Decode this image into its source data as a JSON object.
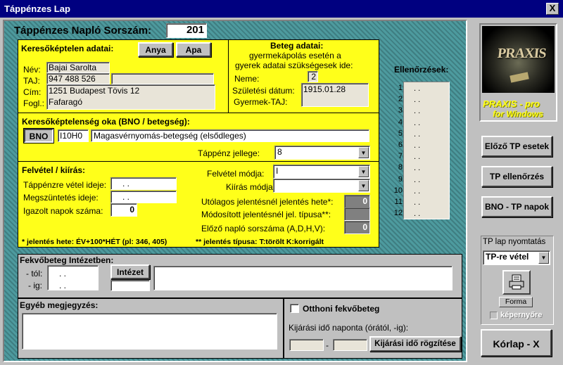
{
  "window": {
    "title": "Táppénzes Lap",
    "close_label": "X"
  },
  "header": {
    "label": "Táppénzes Napló Sorszám:",
    "value": "201"
  },
  "keresokeptelen": {
    "title": "Keresőképtelen adatai:",
    "anya_button": "Anya",
    "apa_button": "Apa",
    "fields": [
      {
        "label": "Név:",
        "value": "Bajai Sarolta"
      },
      {
        "label": "TAJ:",
        "value": "947 488 526"
      },
      {
        "label": "Cím:",
        "value": "1251 Budapest Tövis  12"
      },
      {
        "label": "Fogl.:",
        "value": "Fafaragó"
      }
    ]
  },
  "beteg": {
    "title": "Beteg adatai:",
    "subtitle_line1": "gyermekápolás esetén a",
    "subtitle_line2": "gyerek adatai szükségesek ide:",
    "neme_label": "Neme:",
    "neme_value": "2",
    "szuletesi_label": "Születési dátum:",
    "szuletesi_value": "1915.01.28",
    "gyermek_taj_label": "Gyermek-TAJ:"
  },
  "ok": {
    "title": "Keresőképtelenség oka (BNO / betegség):",
    "bno_button": "BNO",
    "bno_code": "I10H0",
    "bno_desc": "Magasvérnyomás-betegség (elsődleges)",
    "jelleg_label": "Táppénz jellege:",
    "jelleg_value": "8"
  },
  "felvetel": {
    "title": "Felvétel / kiírás:",
    "vetel_label": "Táppénzre vétel ideje:",
    "vetel_value": ". .",
    "megszuntetes_label": "Megszüntetés ideje:",
    "megszuntetes_value": ". .",
    "igazolt_label": "Igazolt napok száma:",
    "igazolt_value": "0",
    "felvetel_modja_label": "Felvétel módja:",
    "felvetel_modja_value": "I",
    "kiiras_modja_label": "Kiírás módja:",
    "kiiras_modja_value": "",
    "utolagos_label": "Utólagos jelentésnél jelentés hete*:",
    "utolagos_value": "0",
    "modositott_label": "Módosított jelentésnél jel. típusa**:",
    "modositott_value": "",
    "elozo_label": "Előző napló sorszáma (A,D,H,V):",
    "elozo_value": "0",
    "note1": "* jelentés hete:  ÉV+100*HÉT  (pl: 346, 405)",
    "note2": "** jelentés típusa:  T:törölt  K:korrigált"
  },
  "fekvobeteg": {
    "title": "Fekvőbeteg Intézetben:",
    "tol_label": "- tól:",
    "tol_value": ". .",
    "ig_label": "- ig:",
    "ig_value": ". .",
    "intezet_button": "Intézet"
  },
  "egyeb": {
    "title": "Egyéb megjegyzés:"
  },
  "otthoni": {
    "checkbox_label": "Otthoni fekvőbeteg",
    "kijarasi_label": "Kijárási idő naponta (órától, -ig):",
    "dash": "-",
    "rogzites_button": "Kijárási idő rögzítése"
  },
  "ellenorzesek": {
    "title": "Ellenőrzések:",
    "rows": [
      {
        "num": "1.",
        "value": ". ."
      },
      {
        "num": "2.",
        "value": ". ."
      },
      {
        "num": "3.",
        "value": ". ."
      },
      {
        "num": "4.",
        "value": ". ."
      },
      {
        "num": "5.",
        "value": ". ."
      },
      {
        "num": "6.",
        "value": ". ."
      },
      {
        "num": "7.",
        "value": ". ."
      },
      {
        "num": "8.",
        "value": ". ."
      },
      {
        "num": "9.",
        "value": ". ."
      },
      {
        "num": "10.",
        "value": ". ."
      },
      {
        "num": "11.",
        "value": ". ."
      },
      {
        "num": "12.",
        "value": ". ."
      }
    ]
  },
  "side": {
    "logo_text": "PRAXIS",
    "logo_line1": "PRAXIS - pro",
    "logo_line2": "for Windows",
    "elozo_tp_button": "Előző TP esetek",
    "tp_ellenorzes_button": "TP ellenőrzés",
    "bno_tp_button": "BNO - TP napok",
    "nyomtatas_label": "TP lap nyomtatás",
    "nyomtatas_value": "TP-re vétel",
    "forma_label": "Forma",
    "kepernyore_label": "képernyőre",
    "korlap_button": "Kórlap - X"
  },
  "colors": {
    "yellow": "#ffff1a",
    "teal": "#4d9a9e",
    "titlebar": "#000080"
  }
}
